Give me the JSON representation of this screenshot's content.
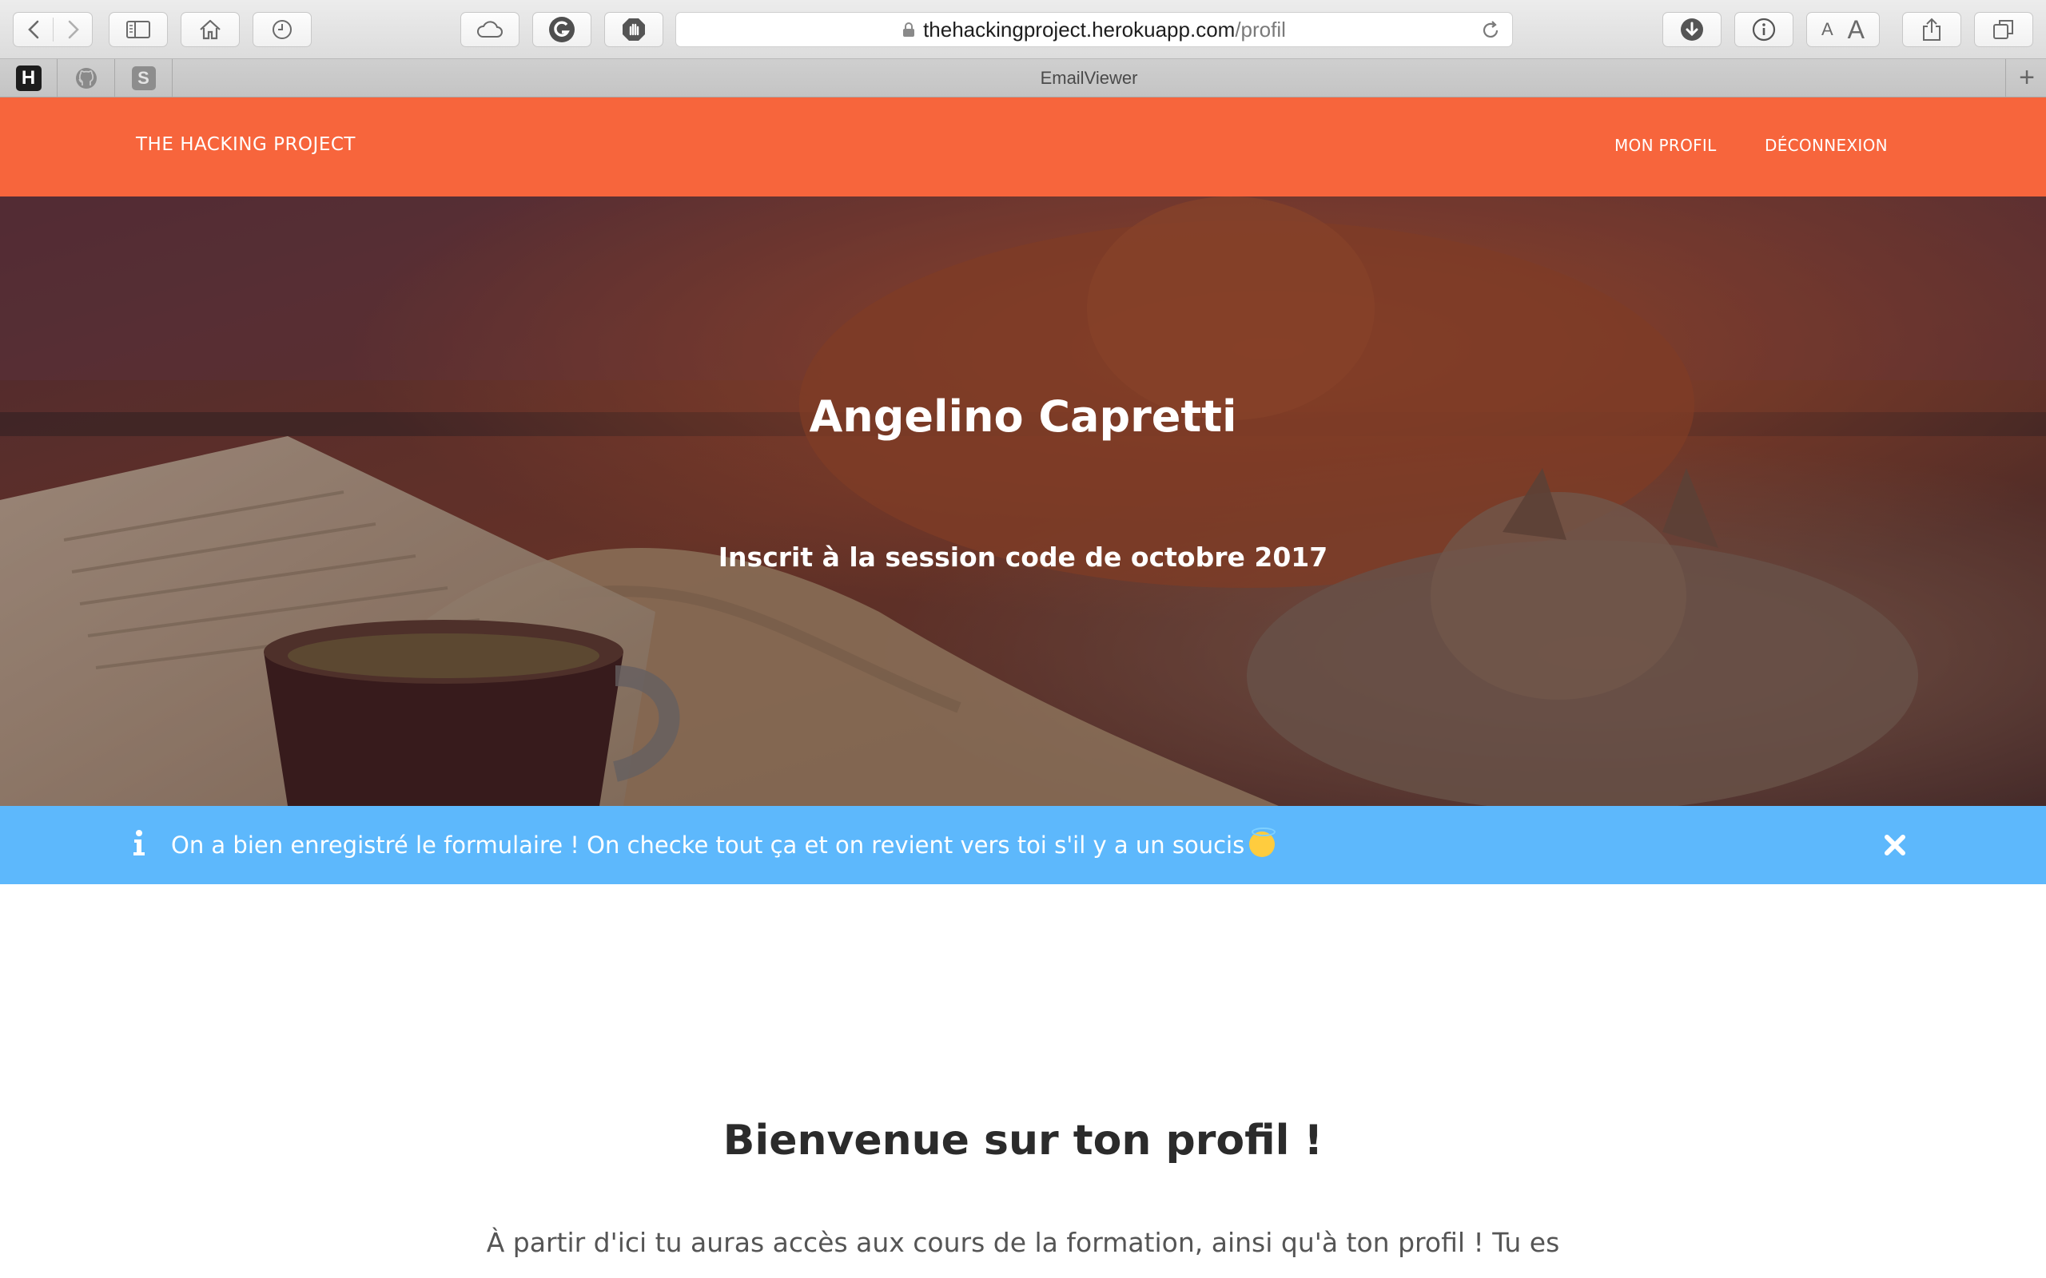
{
  "browser": {
    "url_domain": "thehackingproject.herokuapp.com",
    "url_path": "/profil",
    "font_small_label": "A",
    "font_large_label": "A",
    "pinned_tabs": [
      {
        "label": "H",
        "icon": "hacking-project-favicon"
      },
      {
        "label": "",
        "icon": "github-icon"
      },
      {
        "label": "S",
        "icon": "s-favicon"
      }
    ],
    "active_tab_title": "EmailViewer",
    "new_tab_label": "+"
  },
  "site": {
    "brand": "THE HACKING PROJECT",
    "nav": {
      "profile_label": "MON PROFIL",
      "logout_label": "DÉCONNEXION"
    },
    "colors": {
      "navbar": "#f7653c",
      "alert": "#5db8fc"
    }
  },
  "hero": {
    "name": "Angelino Capretti",
    "session": "Inscrit à la session code de octobre 2017"
  },
  "alert": {
    "icon": "info-icon",
    "message": "On a bien enregistré le formulaire ! On checke tout ça et on revient vers toi s'il y a un soucis",
    "emoji": "smiling-face-with-halo",
    "close_icon": "close-icon"
  },
  "content": {
    "welcome_title": "Bienvenue sur ton profil !",
    "intro_text": "À partir d'ici tu auras accès aux cours de la formation, ainsi qu'à ton profil ! Tu es"
  }
}
